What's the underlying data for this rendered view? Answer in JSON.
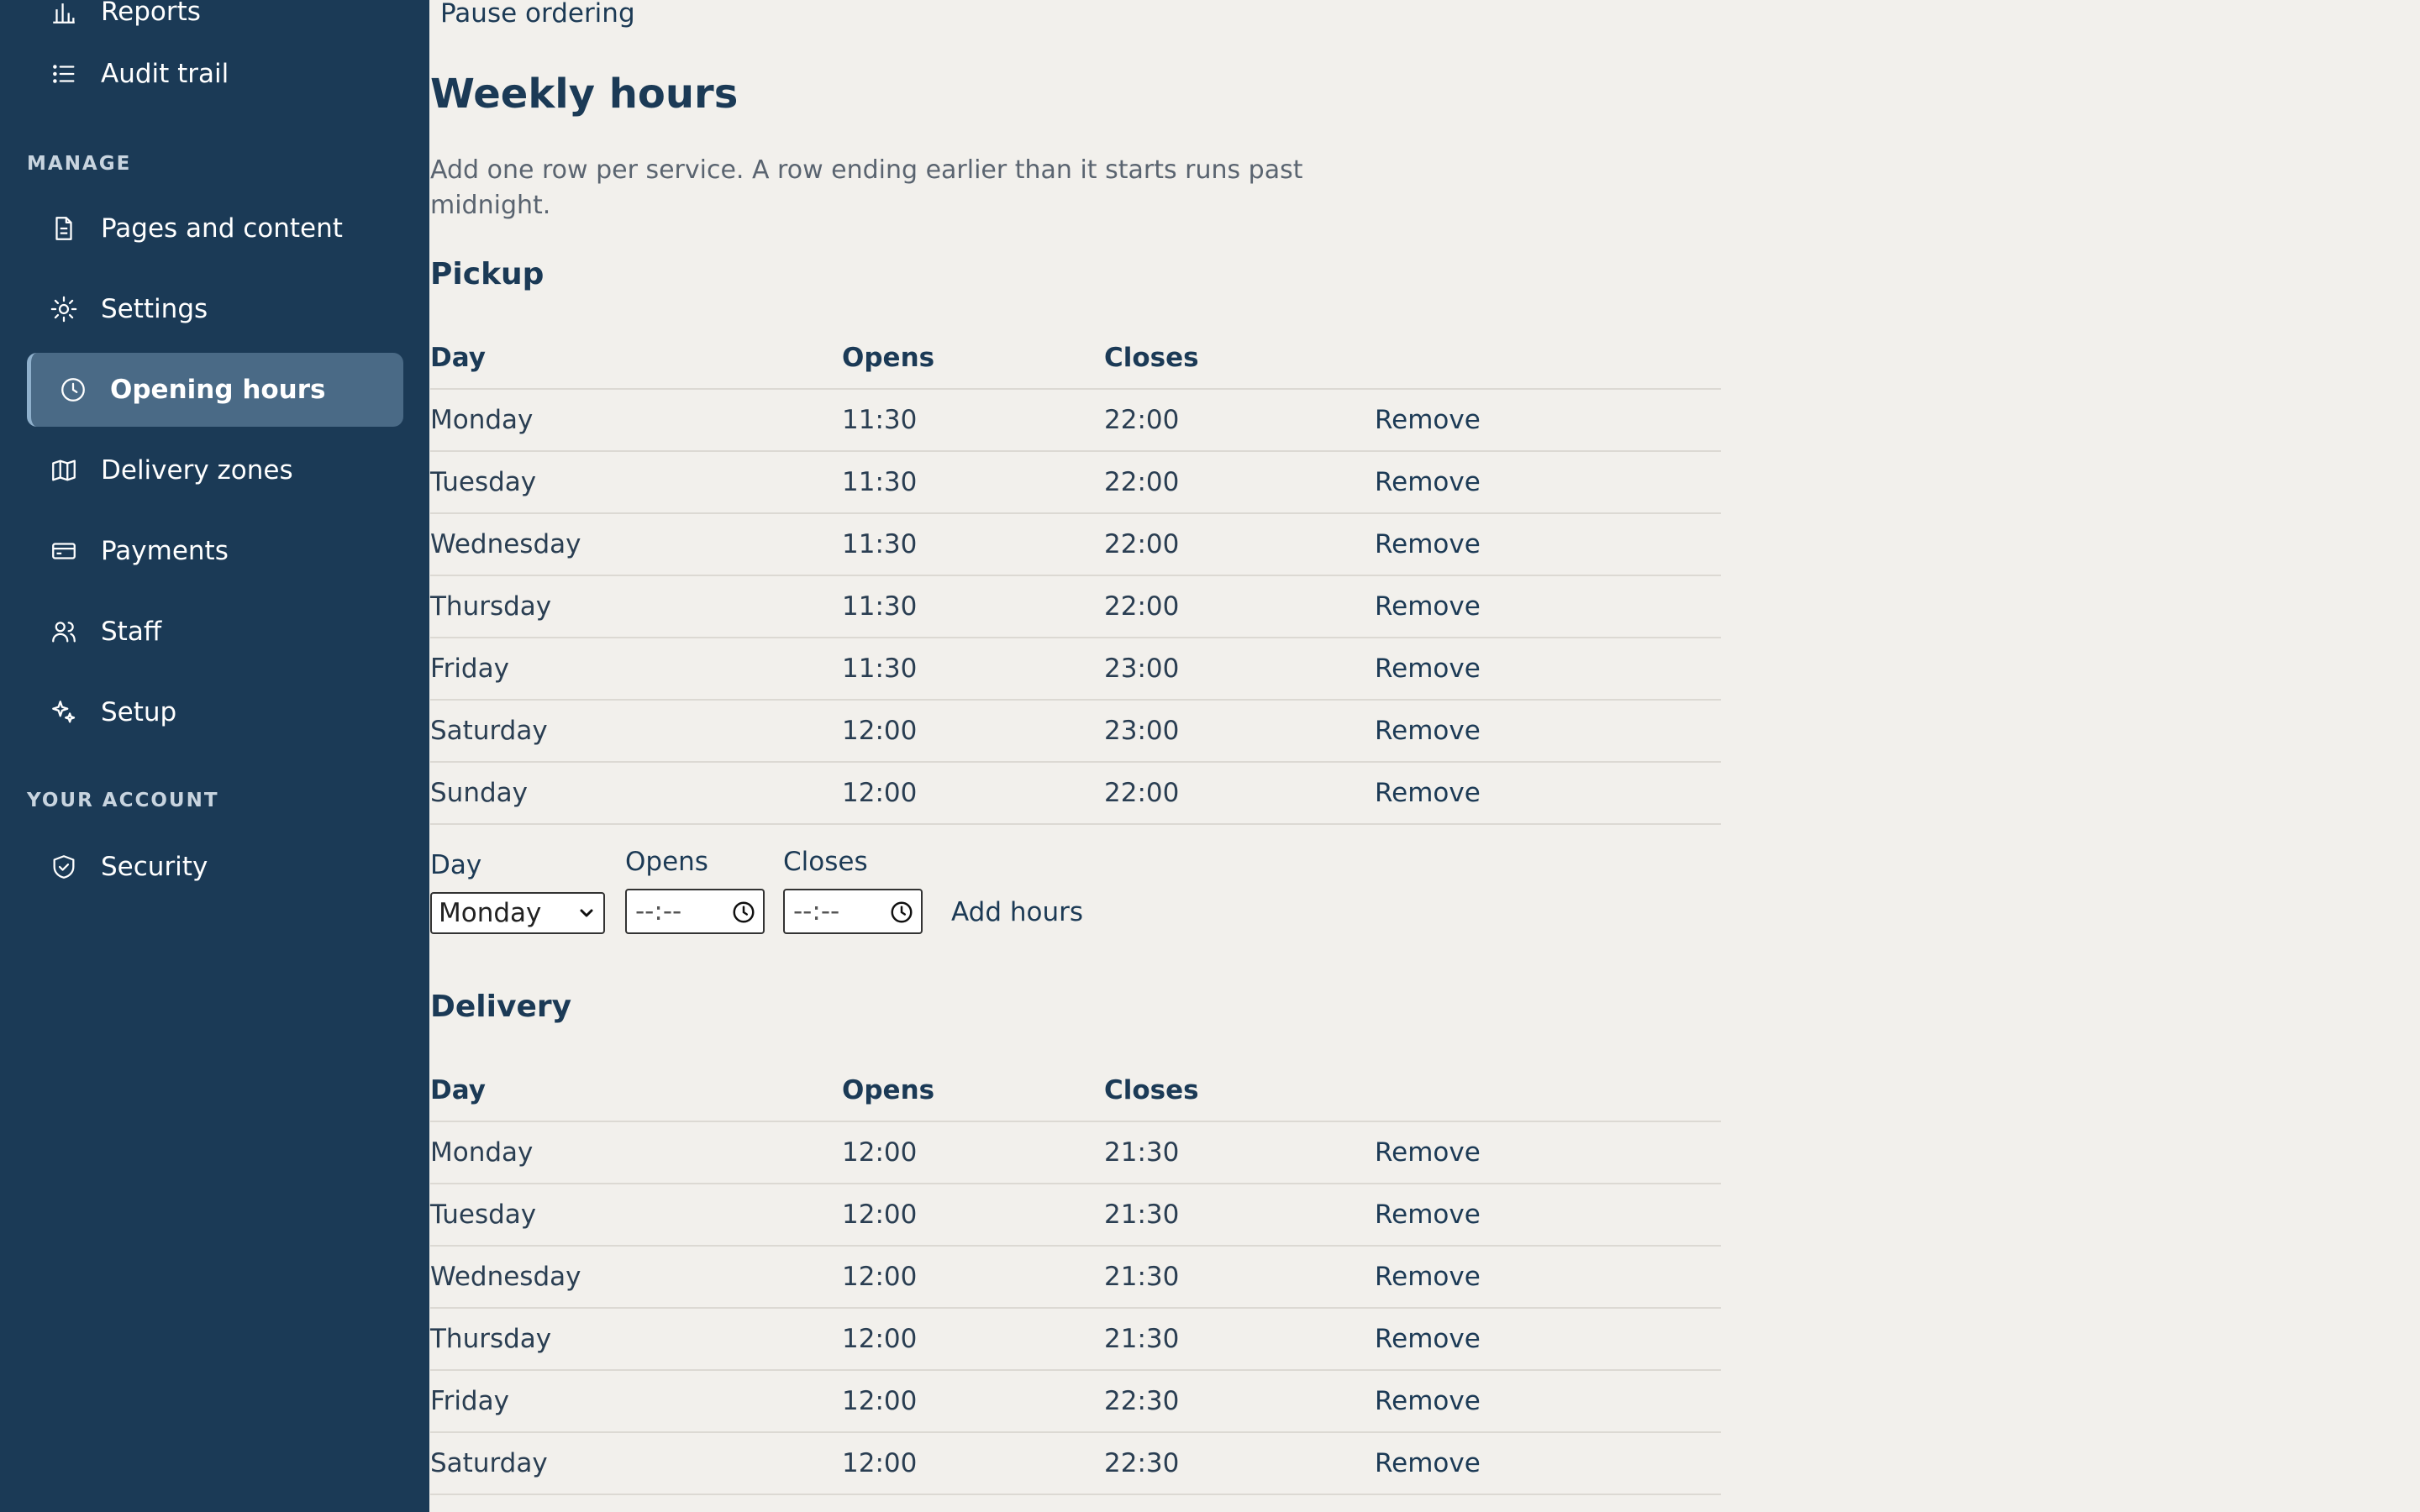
{
  "sidebar": {
    "items": [
      {
        "label": "Reports",
        "icon": "bar-chart-icon"
      },
      {
        "label": "Audit trail",
        "icon": "list-icon"
      },
      {
        "label": "Pages and content",
        "icon": "document-icon"
      },
      {
        "label": "Settings",
        "icon": "sun-icon"
      },
      {
        "label": "Opening hours",
        "icon": "clock-icon"
      },
      {
        "label": "Delivery zones",
        "icon": "map-icon"
      },
      {
        "label": "Payments",
        "icon": "credit-card-icon"
      },
      {
        "label": "Staff",
        "icon": "users-icon"
      },
      {
        "label": "Setup",
        "icon": "sparkles-icon"
      },
      {
        "label": "Security",
        "icon": "shield-icon"
      }
    ],
    "sections": {
      "manage": "MANAGE",
      "account": "YOUR ACCOUNT"
    },
    "active": "Opening hours"
  },
  "main": {
    "pause_ordering": "Pause ordering",
    "title": "Weekly hours",
    "description": "Add one row per service. A row ending earlier than it starts runs past midnight.",
    "columns": {
      "day": "Day",
      "opens": "Opens",
      "closes": "Closes"
    },
    "remove_label": "Remove",
    "pickup": {
      "title": "Pickup",
      "rows": [
        {
          "day": "Monday",
          "opens": "11:30",
          "closes": "22:00"
        },
        {
          "day": "Tuesday",
          "opens": "11:30",
          "closes": "22:00"
        },
        {
          "day": "Wednesday",
          "opens": "11:30",
          "closes": "22:00"
        },
        {
          "day": "Thursday",
          "opens": "11:30",
          "closes": "22:00"
        },
        {
          "day": "Friday",
          "opens": "11:30",
          "closes": "23:00"
        },
        {
          "day": "Saturday",
          "opens": "12:00",
          "closes": "23:00"
        },
        {
          "day": "Sunday",
          "opens": "12:00",
          "closes": "22:00"
        }
      ]
    },
    "add_form": {
      "day_label": "Day",
      "day_value": "Monday",
      "opens_label": "Opens",
      "opens_placeholder": "--:--",
      "closes_label": "Closes",
      "closes_placeholder": "--:--",
      "add_label": "Add hours"
    },
    "delivery": {
      "title": "Delivery",
      "rows": [
        {
          "day": "Monday",
          "opens": "12:00",
          "closes": "21:30"
        },
        {
          "day": "Tuesday",
          "opens": "12:00",
          "closes": "21:30"
        },
        {
          "day": "Wednesday",
          "opens": "12:00",
          "closes": "21:30"
        },
        {
          "day": "Thursday",
          "opens": "12:00",
          "closes": "21:30"
        },
        {
          "day": "Friday",
          "opens": "12:00",
          "closes": "22:30"
        },
        {
          "day": "Saturday",
          "opens": "12:00",
          "closes": "22:30"
        }
      ]
    }
  },
  "colors": {
    "sidebar_bg": "#1b3a56",
    "active_item_bg": "#4a6a86",
    "page_bg": "#f2f0ec",
    "heading": "#1b3a56"
  }
}
